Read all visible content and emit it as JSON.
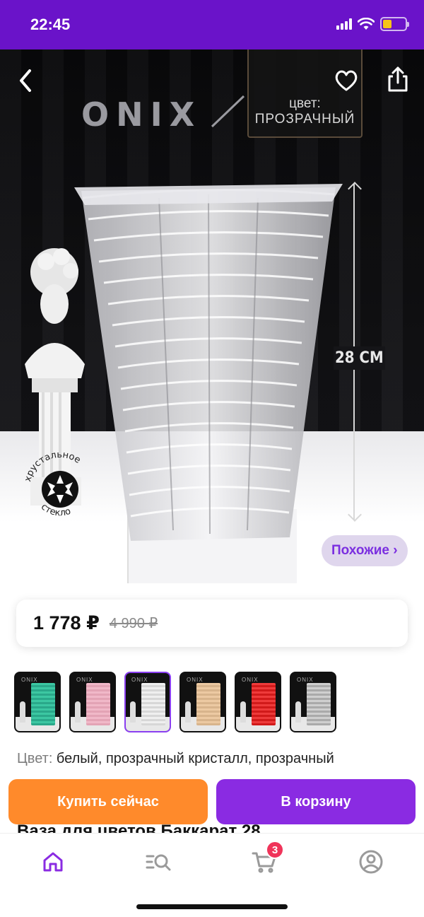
{
  "status_bar": {
    "time": "22:45"
  },
  "hero": {
    "brand": "ONIX",
    "color_tag": {
      "label": "цвет:",
      "value": "ПРОЗРАЧНЫЙ"
    },
    "dimension": "28 CM",
    "badge": {
      "top_text": "хрустальное",
      "bottom_text": "стекло"
    },
    "similar_label": "Похожие ›",
    "icons": {
      "back": "chevron-left-icon",
      "favorite": "heart-icon",
      "share": "share-icon"
    }
  },
  "price": {
    "current": "1 778 ₽",
    "old": "4 990 ₽"
  },
  "variants": [
    {
      "color": "#2aa88a",
      "accent": "#3cc7a2",
      "selected": false
    },
    {
      "color": "#e3a3b5",
      "accent": "#f0b8c8",
      "selected": false
    },
    {
      "color": "#d7d7d7",
      "accent": "#efefef",
      "selected": true
    },
    {
      "color": "#d8b48c",
      "accent": "#ecc9a2",
      "selected": false
    },
    {
      "color": "#d11a1a",
      "accent": "#ee3b3b",
      "selected": false
    },
    {
      "color": "#aaaaaa",
      "accent": "#cfcfcf",
      "selected": false
    }
  ],
  "color_info": {
    "key": "Цвет:",
    "value": " белый, прозрачный кристалл, прозрачный"
  },
  "product_title": "Ваза для цветов Баккарат 28",
  "actions": {
    "buy_now": "Купить сейчас",
    "add_to_cart": "В корзину"
  },
  "tabbar": {
    "items": [
      {
        "name": "home",
        "icon": "home-icon",
        "active": true
      },
      {
        "name": "catalog",
        "icon": "catalog-search-icon",
        "active": false
      },
      {
        "name": "cart",
        "icon": "cart-icon",
        "active": false
      },
      {
        "name": "profile",
        "icon": "profile-icon",
        "active": false
      }
    ],
    "cart_count": "3"
  },
  "colors": {
    "accent": "#8a2be2",
    "status_bar": "#6a13c9",
    "buy_now": "#ff8a2b",
    "badge": "#f0345a"
  }
}
